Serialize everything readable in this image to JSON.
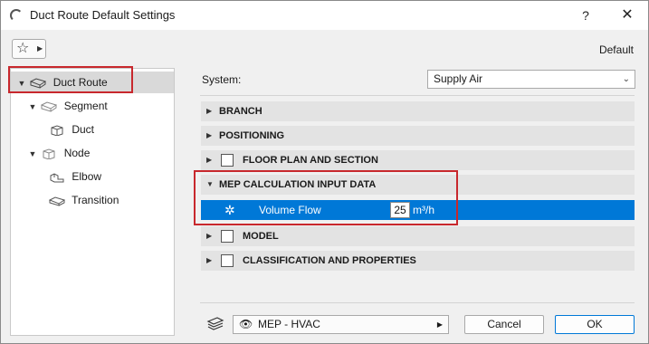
{
  "window": {
    "title": "Duct Route Default Settings",
    "help": "?",
    "close": "✕"
  },
  "toolbar": {
    "favorites_icon": "star-icon",
    "default_label": "Default"
  },
  "tree": {
    "items": [
      {
        "label": "Duct Route",
        "icon": "duct-route-icon",
        "expanded": true,
        "selected": true
      },
      {
        "label": "Segment",
        "icon": "segment-icon",
        "expanded": true
      },
      {
        "label": "Duct",
        "icon": "duct-icon"
      },
      {
        "label": "Node",
        "icon": "node-icon",
        "expanded": true
      },
      {
        "label": "Elbow",
        "icon": "elbow-icon"
      },
      {
        "label": "Transition",
        "icon": "transition-icon"
      }
    ]
  },
  "system": {
    "label": "System:",
    "value": "Supply Air"
  },
  "sections": [
    {
      "label": "BRANCH",
      "expanded": false
    },
    {
      "label": "POSITIONING",
      "expanded": false
    },
    {
      "label": "FLOOR PLAN AND SECTION",
      "expanded": false
    },
    {
      "label": "MEP CALCULATION INPUT DATA",
      "expanded": true
    },
    {
      "label": "MODEL",
      "expanded": false
    },
    {
      "label": "CLASSIFICATION AND PROPERTIES",
      "expanded": false
    }
  ],
  "param": {
    "label": "Volume Flow",
    "value": "25",
    "unit": "m³/h"
  },
  "footer": {
    "view_label": "MEP - HVAC",
    "cancel": "Cancel",
    "ok": "OK"
  },
  "colors": {
    "accent": "#0078d7",
    "highlight": "#c8282d"
  }
}
